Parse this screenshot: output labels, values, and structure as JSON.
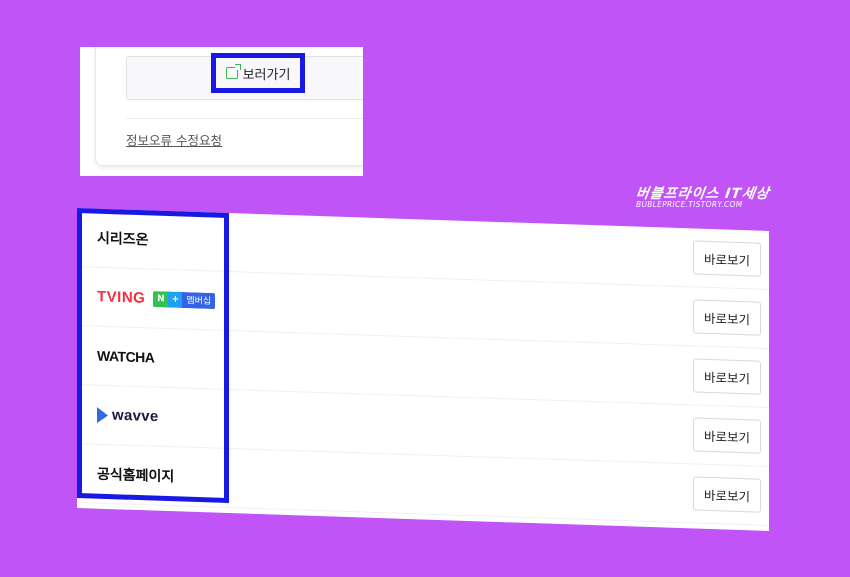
{
  "top_card": {
    "watch_label": "보러가기",
    "report_link": "정보오류 수정요청"
  },
  "watermark": {
    "title": "버블프라이스 IT세상",
    "subtitle": "BUBLEPRICE.TISTORY.COM"
  },
  "providers": [
    {
      "name": "시리즈온",
      "logo": "text",
      "watch_label": "바로보기"
    },
    {
      "name": "TVING",
      "logo": "tving",
      "badge": {
        "n": "N",
        "plus": "+",
        "text": "멤버십"
      },
      "watch_label": "바로보기"
    },
    {
      "name": "WATCHA",
      "logo": "watcha",
      "watch_label": "바로보기"
    },
    {
      "name": "wavve",
      "logo": "wavve",
      "watch_label": "바로보기"
    },
    {
      "name": "공식홈페이지",
      "logo": "text",
      "watch_label": "바로보기"
    }
  ],
  "colors": {
    "background": "#c054f6",
    "highlight": "#1919e6",
    "tving": "#f52d3a",
    "watcha": "#f2385a",
    "wavve": "#2f6be8"
  }
}
